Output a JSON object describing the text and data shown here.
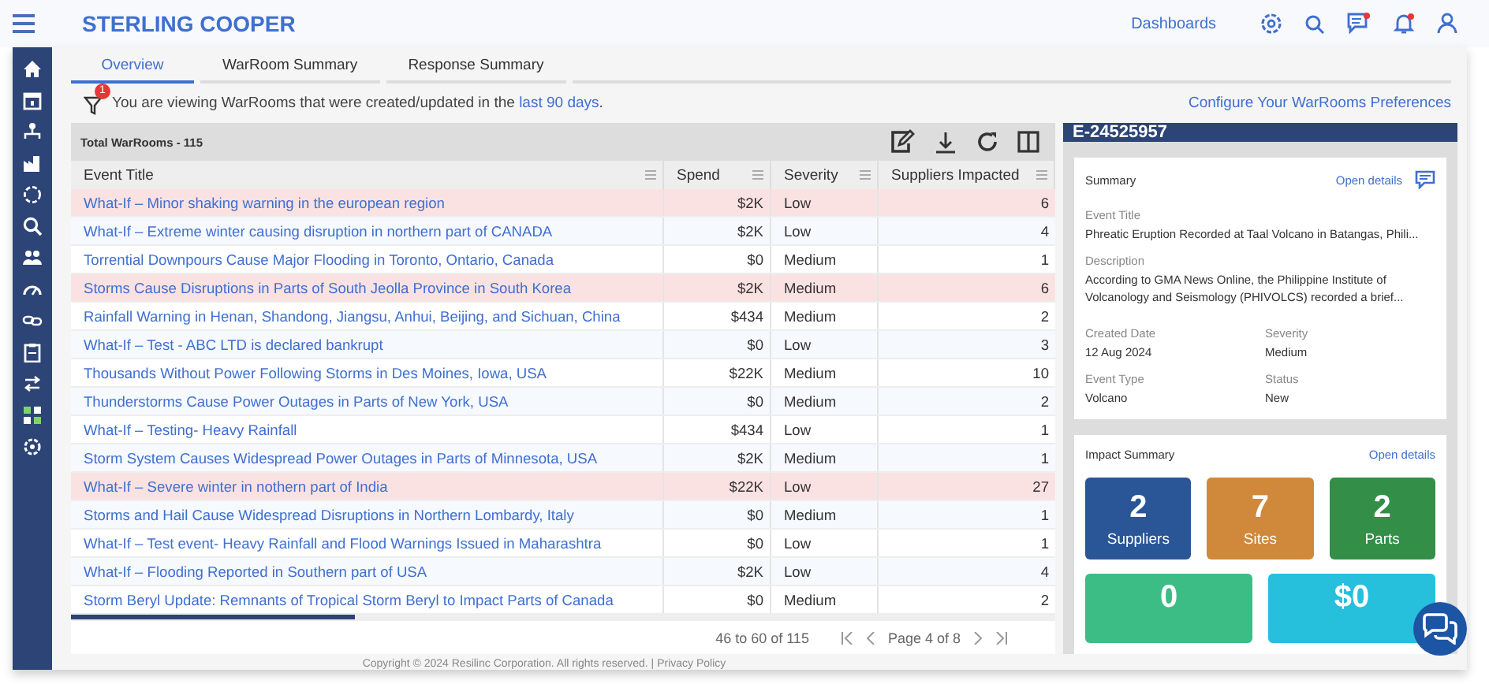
{
  "header": {
    "brand": "STERLING COOPER",
    "nav_link": "Dashboards",
    "notifications": {
      "messages": true,
      "alerts": true
    }
  },
  "tabs": [
    {
      "label": "Overview",
      "selected": true
    },
    {
      "label": "WarRoom Summary",
      "selected": false
    },
    {
      "label": "Response Summary",
      "selected": false
    }
  ],
  "filter_notice": {
    "badge": "1",
    "text": "You are viewing WarRooms that were created/updated in the ",
    "link": "last 90 days",
    "end": "."
  },
  "preferences_link": "Configure Your WarRooms Preferences",
  "table": {
    "total": "Total WarRooms - 115",
    "columns": [
      "Event Title",
      "Spend",
      "Severity",
      "Suppliers Impacted"
    ],
    "rows": [
      {
        "title": "What-If – Minor shaking warning in the european region",
        "spend": "$2K",
        "severity": "Low",
        "suppliers": "6",
        "highlighted": true
      },
      {
        "title": "What-If – Extreme winter causing disruption in northern part of CANADA",
        "spend": "$2K",
        "severity": "Low",
        "suppliers": "4",
        "highlighted": false
      },
      {
        "title": "Torrential Downpours Cause Major Flooding in Toronto, Ontario, Canada",
        "spend": "$0",
        "severity": "Medium",
        "suppliers": "1",
        "highlighted": false
      },
      {
        "title": "Storms Cause Disruptions in Parts of South Jeolla Province in South Korea",
        "spend": "$2K",
        "severity": "Medium",
        "suppliers": "6",
        "highlighted": true
      },
      {
        "title": "Rainfall Warning in Henan, Shandong, Jiangsu, Anhui, Beijing, and Sichuan, China",
        "spend": "$434",
        "severity": "Medium",
        "suppliers": "2",
        "highlighted": false
      },
      {
        "title": "What-If – Test - ABC LTD is declared bankrupt",
        "spend": "$0",
        "severity": "Low",
        "suppliers": "3",
        "highlighted": false
      },
      {
        "title": "Thousands Without Power Following Storms in Des Moines, Iowa, USA",
        "spend": "$22K",
        "severity": "Medium",
        "suppliers": "10",
        "highlighted": false
      },
      {
        "title": "Thunderstorms Cause Power Outages in Parts of New York, USA",
        "spend": "$0",
        "severity": "Medium",
        "suppliers": "2",
        "highlighted": false
      },
      {
        "title": "What-If – Testing- Heavy Rainfall",
        "spend": "$434",
        "severity": "Low",
        "suppliers": "1",
        "highlighted": false
      },
      {
        "title": "Storm System Causes Widespread Power Outages in Parts of Minnesota, USA",
        "spend": "$2K",
        "severity": "Medium",
        "suppliers": "1",
        "highlighted": false
      },
      {
        "title": "What-If – Severe winter in nothern part of India",
        "spend": "$22K",
        "severity": "Low",
        "suppliers": "27",
        "highlighted": true
      },
      {
        "title": "Storms and Hail Cause Widespread Disruptions in Northern Lombardy, Italy",
        "spend": "$0",
        "severity": "Medium",
        "suppliers": "1",
        "highlighted": false
      },
      {
        "title": "What-If – Test event- Heavy Rainfall and Flood Warnings Issued in Maharashtra",
        "spend": "$0",
        "severity": "Low",
        "suppliers": "1",
        "highlighted": false
      },
      {
        "title": "What-If – Flooding Reported in Southern part of USA",
        "spend": "$2K",
        "severity": "Low",
        "suppliers": "4",
        "highlighted": false
      },
      {
        "title": "Storm Beryl Update: Remnants of Tropical Storm Beryl to Impact Parts of Canada",
        "spend": "$0",
        "severity": "Medium",
        "suppliers": "2",
        "highlighted": false
      }
    ],
    "pagination": {
      "range": "46 to 60 of 115",
      "page": "Page 4 of 8"
    }
  },
  "detail": {
    "id": "E-24525957",
    "summary": {
      "title": "Summary",
      "open_link": "Open details",
      "fields": [
        {
          "label": "Event Title",
          "value": "Phreatic Eruption Recorded at Taal Volcano in Batangas, Phili..."
        },
        {
          "label": "Description",
          "value": "According to GMA News Online, the Philippine Institute of Volcanology and Seismology (PHIVOLCS) recorded a brief..."
        }
      ],
      "pairs": [
        {
          "label": "Created Date",
          "value": "12 Aug 2024"
        },
        {
          "label": "Severity",
          "value": "Medium"
        },
        {
          "label": "Event Type",
          "value": "Volcano"
        },
        {
          "label": "Status",
          "value": "New"
        }
      ]
    },
    "impact": {
      "title": "Impact Summary",
      "open_link": "Open details",
      "tiles": [
        {
          "value": "2",
          "label": "Suppliers",
          "color": "#2a5597"
        },
        {
          "value": "7",
          "label": "Sites",
          "color": "#d0883a"
        },
        {
          "value": "2",
          "label": "Parts",
          "color": "#338f47"
        }
      ],
      "tiles_lower": [
        {
          "value": "0",
          "color": "#3dbd86"
        },
        {
          "value": "$0",
          "color": "#26bfdc"
        }
      ]
    }
  },
  "footer": "Copyright © 2024 Resilinc Corporation. All rights reserved. | Privacy Policy"
}
